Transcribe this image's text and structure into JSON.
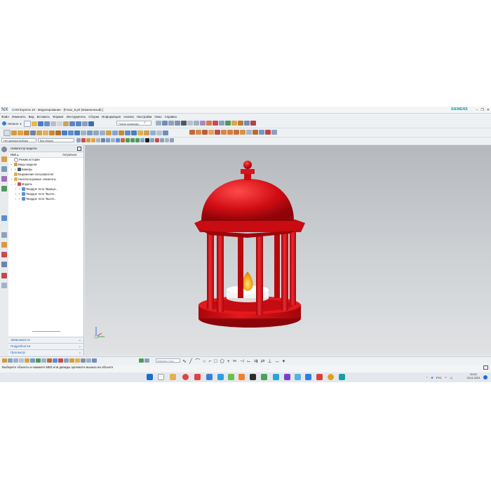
{
  "window": {
    "logo": "NX",
    "title": "CAM Express 10 - Моделирование - [Fonar_5.prt (Измененный) ]",
    "brand": "SIEMENS",
    "minimize": "–",
    "restore": "❐",
    "close": "✕"
  },
  "menu": {
    "items": [
      "Файл",
      "Изменить",
      "Вид",
      "Вставить",
      "Формат",
      "Инструменты",
      "Сборки",
      "Информация",
      "Анализ",
      "Настройки",
      "Окно",
      "Справка"
    ]
  },
  "toolbar": {
    "start_label": "Начало",
    "command_search_placeholder": "Поиск команды",
    "filter_label": "Нет фильтра выбора",
    "assembly_scope": "Вся сборка"
  },
  "navigator": {
    "title": "Навигатор модели",
    "col_name": "Имя",
    "col_status": "Актуально",
    "items": [
      {
        "label": "Режим истории",
        "toggle": ""
      },
      {
        "label": "Виды модели",
        "toggle": "+"
      },
      {
        "label": "Камеры",
        "toggle": "+"
      },
      {
        "label": "Выражения пользователя",
        "toggle": ""
      },
      {
        "label": "Неиспользуемые элементы",
        "toggle": "+"
      },
      {
        "label": "Модель",
        "toggle": "–"
      },
      {
        "label": "Твердое тело \"Враща...",
        "toggle": "+"
      },
      {
        "label": "Твердое тело \"Вытяг...",
        "toggle": "+"
      },
      {
        "label": "Твердое тело \"Вытяг...",
        "toggle": "+"
      }
    ],
    "panels": [
      "Зависимости",
      "Подробности",
      "Просмотр"
    ]
  },
  "bottom_toolbar": {
    "snap_placeholder": "Захватить точку"
  },
  "status": {
    "text": "Выберите объекты и нажмите MB3 или дважды щелкните мышью на объекте"
  },
  "taskbar": {
    "lang": "РУС",
    "time": "20:02",
    "date": "03.11.2023"
  },
  "colors": {
    "accent": "#2a66b0",
    "brand": "#009999",
    "model_red": "#d10d14",
    "flame": "#f2a81d"
  },
  "icons": [
    "nx-logo-icon",
    "save-icon",
    "undo-icon",
    "redo-icon",
    "search-icon",
    "chevron-down-icon",
    "wcs-triad-icon",
    "windows-start-icon"
  ]
}
